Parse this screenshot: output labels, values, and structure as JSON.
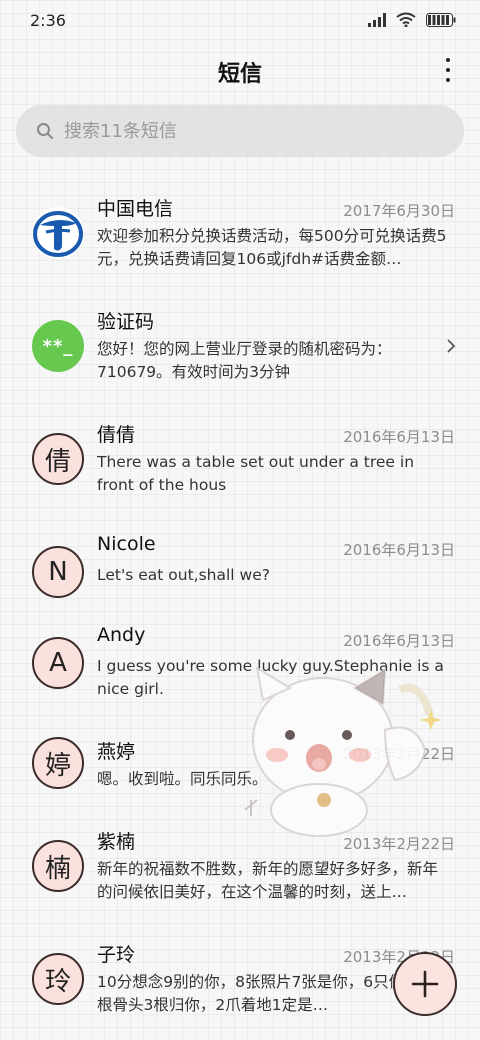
{
  "status_bar": {
    "time": "2:36"
  },
  "header": {
    "title": "短信"
  },
  "search": {
    "placeholder": "搜索11条短信"
  },
  "conversations": [
    {
      "name": "中国电信",
      "date": "2017年6月30日",
      "preview": "欢迎参加积分兑换话费活动，每500分可兑换话费5元，兑换话费请回复106或jfdh#话费金额…",
      "avatar": "telecom-logo"
    },
    {
      "name": "验证码",
      "date": "",
      "preview": "您好！您的网上营业厅登录的随机密码为：710679。有效时间为3分钟",
      "avatar_text": "**_"
    },
    {
      "name": "倩倩",
      "date": "2016年6月13日",
      "preview": "There was a table set out under a tree in front of the hous",
      "avatar_text": "倩"
    },
    {
      "name": "Nicole",
      "date": "2016年6月13日",
      "preview": "Let's eat out,shall we?",
      "avatar_text": "N"
    },
    {
      "name": "Andy",
      "date": "2016年6月13日",
      "preview": "I guess you're some lucky guy.Stephanie is a nice girl.",
      "avatar_text": "A"
    },
    {
      "name": "燕婷",
      "date": "2013年2月22日",
      "preview": "嗯。收到啦。同乐同乐。",
      "avatar_text": "婷"
    },
    {
      "name": "紫楠",
      "date": "2013年2月22日",
      "preview": "新年的祝福数不胜数，新年的愿望好多好多，新年的问候依旧美好，在这个温馨的时刻，送上…",
      "avatar_text": "楠"
    },
    {
      "name": "子玲",
      "date": "2013年2月22日",
      "preview": "10分想念9别的你，8张照片7张是你，6只像你，4根骨头3根归你，2爪着地1定是…",
      "avatar_text": "玲"
    }
  ],
  "icons": {
    "more": "more-vertical-icon",
    "search": "search-icon",
    "chevron": "chevron-right-icon",
    "fab": "plus-icon",
    "signal": "signal-icon",
    "wifi": "wifi-icon",
    "battery": "battery-icon"
  },
  "colors": {
    "accent_border": "#3b2b2b",
    "avatar_fill": "#fbe1dd",
    "code_avatar": "#67c84f",
    "telecom_blue": "#1a5bb0",
    "date_text": "#8d8d8d"
  }
}
